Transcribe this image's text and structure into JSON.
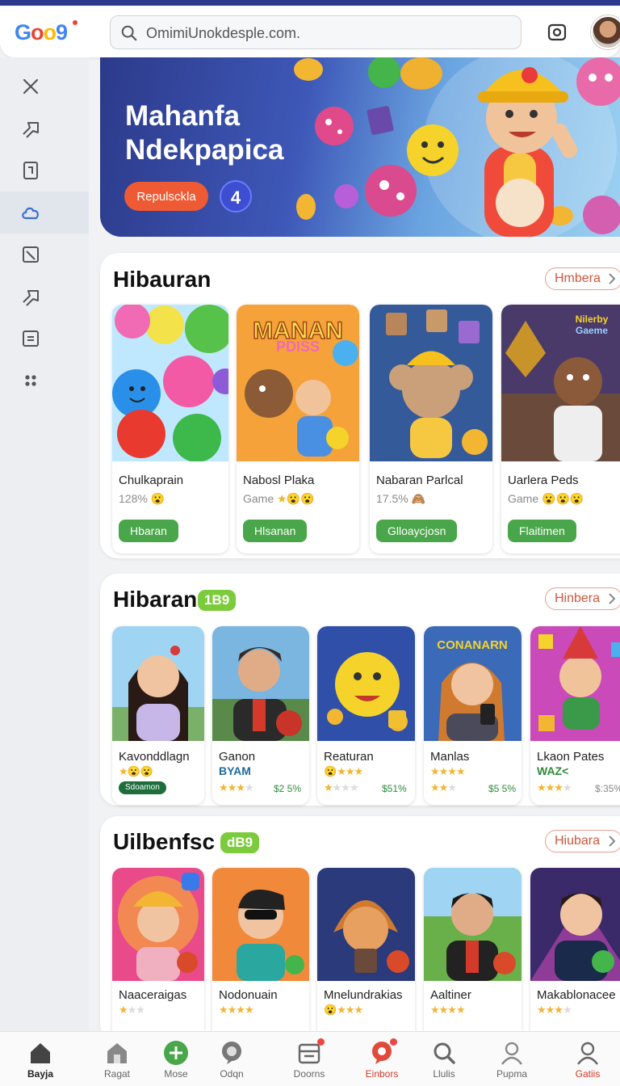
{
  "header": {
    "logo_text": "Goo9",
    "search_value": "OmimiUnokdesple.com."
  },
  "hero": {
    "title_line1": "Mahanfa",
    "title_line2": "Ndekpapica",
    "button_label": "Repulsckla",
    "badge_value": "4"
  },
  "sections": [
    {
      "title": "Hibauran",
      "chip": "",
      "more_label": "Hmbera",
      "cards": [
        {
          "name": "Chulkaprain",
          "sub": "128%",
          "button": "Hbaran"
        },
        {
          "name": "Nabosl Plaka",
          "sub": "Game",
          "button": "Hlsanan"
        },
        {
          "name": "Nabaran Parlcal",
          "sub": "17.5%",
          "button": "Glloaycjosn"
        },
        {
          "name": "Uarlera Peds",
          "sub": "Game",
          "button": "Flaitimen"
        }
      ]
    },
    {
      "title": "Hibaran",
      "chip": "1B9",
      "more_label": "Hinbera",
      "cards": [
        {
          "name": "Kavonddlagn",
          "tag": "",
          "pill": "Sdoamon",
          "price": ""
        },
        {
          "name": "Ganon",
          "tag": "ΒΥΑΜ",
          "pill": "",
          "price": "$2 5%"
        },
        {
          "name": "Reaturan",
          "tag": "",
          "pill": "",
          "price": "$51%"
        },
        {
          "name": "Manlas",
          "tag": "",
          "pill": "",
          "price": "$5 5%"
        },
        {
          "name": "Lkaon Pates",
          "tag": "WAZ<",
          "pill": "",
          "price": "$:35%"
        }
      ]
    },
    {
      "title": "Uilbenfsc",
      "chip": "dB9",
      "more_label": "Hiubara",
      "cards": [
        {
          "name": "Naaceraigas"
        },
        {
          "name": "Nodonuain"
        },
        {
          "name": "Mnelundrakias"
        },
        {
          "name": "Aaltiner"
        },
        {
          "name": "Makablonacee"
        }
      ]
    }
  ],
  "bottom_nav": [
    {
      "label": "Bayja",
      "icon": "home-icon",
      "active": true
    },
    {
      "label": "Ragat",
      "icon": "store-icon"
    },
    {
      "label": "Mose",
      "icon": "plus-icon"
    },
    {
      "label": "Odqn",
      "icon": "chat-icon"
    },
    {
      "label": "Doorns",
      "icon": "inbox-icon"
    },
    {
      "label": "Einbors",
      "icon": "messages-icon"
    },
    {
      "label": "Llulis",
      "icon": "search-icon"
    },
    {
      "label": "Pupma",
      "icon": "profile-icon"
    },
    {
      "label": "Gatiis",
      "icon": "account-icon"
    }
  ],
  "colors": {
    "accent_orange": "#ee5a33",
    "accent_green": "#4aa64a",
    "header_blue": "#2b3a8c",
    "link_red": "#d4553a"
  }
}
